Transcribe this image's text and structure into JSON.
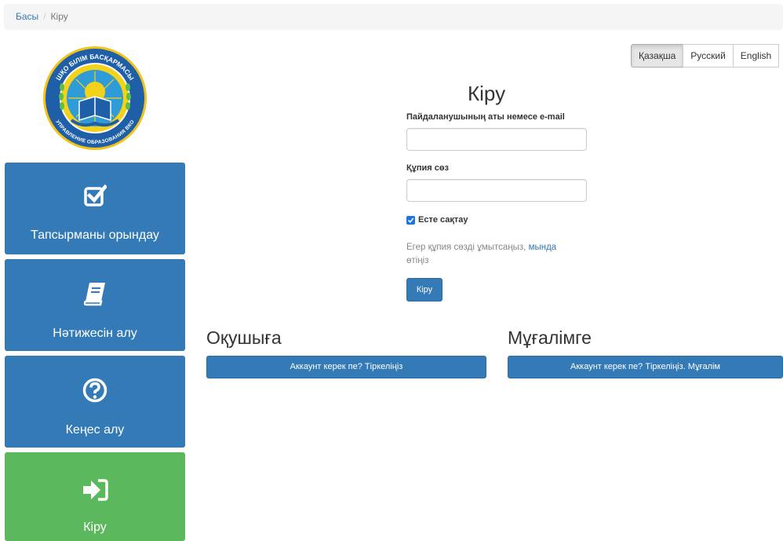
{
  "breadcrumb": {
    "home": "Басы",
    "separator": "/",
    "current": "Кіру"
  },
  "logo": {
    "top_text": "ШҚО БІЛІМ БАСҚАРМАСЫ",
    "bottom_text": "УПРАВЛЕНИЕ ОБРАЗОВАНИЯ ВКО",
    "icon": "emblem-icon"
  },
  "sidebar": {
    "tiles": [
      {
        "label": "Тапсырманы орындау",
        "icon": "checkbox-icon",
        "color": "#337ab7"
      },
      {
        "label": "Нәтижесін алу",
        "icon": "book-icon",
        "color": "#337ab7"
      },
      {
        "label": "Кеңес алу",
        "icon": "question-circle-icon",
        "color": "#337ab7"
      },
      {
        "label": "Кіру",
        "icon": "sign-in-icon",
        "color": "#5cb85c"
      }
    ]
  },
  "languages": [
    {
      "label": "Қазақша",
      "active": true
    },
    {
      "label": "Русский",
      "active": false
    },
    {
      "label": "English",
      "active": false
    }
  ],
  "login": {
    "title": "Кіру",
    "username_label": "Пайдаланушының аты немесе e-mail",
    "username_value": "",
    "password_label": "Құпия сөз",
    "password_value": "",
    "remember_label": "Есте сақтау",
    "remember_checked": true,
    "forgot_prefix": "Егер құпия сөзді ұмытсаңыз,",
    "forgot_link": "мында",
    "forgot_suffix": "өтіңіз",
    "submit_label": "Кіру"
  },
  "student": {
    "title": "Оқушыға",
    "button": "Аккаунт керек пе? Тіркеліңіз"
  },
  "teacher": {
    "title": "Мұғалімге",
    "button": "Аккаунт керек пе? Тіркеліңіз. Мұғалім"
  },
  "colors": {
    "primary": "#337ab7",
    "success": "#5cb85c",
    "link": "#337ab7"
  }
}
